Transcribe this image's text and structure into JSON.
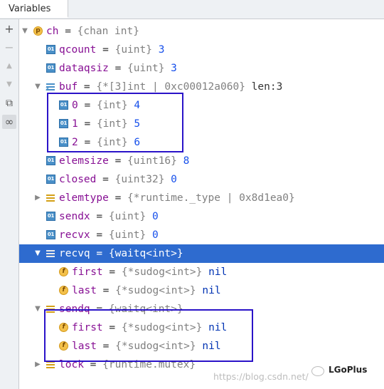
{
  "panel": {
    "title": "Variables"
  },
  "toolbar": {
    "add": "+",
    "remove": "−",
    "up": "▲",
    "down": "▼",
    "copy": "⧉",
    "watch": "∞"
  },
  "rows": [
    {
      "name": "ch",
      "sep": " = ",
      "type": "{chan int}",
      "val": ""
    },
    {
      "name": "qcount",
      "sep": " = ",
      "type": "{uint}",
      "val": " 3"
    },
    {
      "name": "dataqsiz",
      "sep": " = ",
      "type": "{uint}",
      "val": " 3"
    },
    {
      "name": "buf",
      "sep": " = ",
      "type": "{*[3]int | 0xc00012a060}",
      "val": " len:3"
    },
    {
      "name": "0",
      "sep": " = ",
      "type": "{int}",
      "val": " 4"
    },
    {
      "name": "1",
      "sep": " = ",
      "type": "{int}",
      "val": " 5"
    },
    {
      "name": "2",
      "sep": " = ",
      "type": "{int}",
      "val": " 6"
    },
    {
      "name": "elemsize",
      "sep": " = ",
      "type": "{uint16}",
      "val": " 8"
    },
    {
      "name": "closed",
      "sep": " = ",
      "type": "{uint32}",
      "val": " 0"
    },
    {
      "name": "elemtype",
      "sep": " = ",
      "type": "{*runtime._type | 0x8d1ea0}",
      "val": ""
    },
    {
      "name": "sendx",
      "sep": " = ",
      "type": "{uint}",
      "val": " 0"
    },
    {
      "name": "recvx",
      "sep": " = ",
      "type": "{uint}",
      "val": " 0"
    },
    {
      "name": "recvq",
      "sep": " = ",
      "type": "{waitq<int>}",
      "val": ""
    },
    {
      "name": "first",
      "sep": " = ",
      "type": "{*sudog<int>}",
      "val": " nil"
    },
    {
      "name": "last",
      "sep": " = ",
      "type": "{*sudog<int>}",
      "val": " nil"
    },
    {
      "name": "sendq",
      "sep": " = ",
      "type": "{waitq<int>}",
      "val": ""
    },
    {
      "name": "first",
      "sep": " = ",
      "type": "{*sudog<int>}",
      "val": " nil"
    },
    {
      "name": "last",
      "sep": " = ",
      "type": "{*sudog<int>}",
      "val": " nil"
    },
    {
      "name": "lock",
      "sep": " = ",
      "type": "{runtime.mutex}",
      "val": ""
    }
  ],
  "icons": {
    "p": "p",
    "f": "f",
    "num": "01",
    "arr": "3"
  },
  "watermark": {
    "url": "https://blog.csdn.net/",
    "brand": "LGoPlus"
  },
  "colors": {
    "selection": "#2e6bcf",
    "highlight_box": "#2a13c8"
  }
}
